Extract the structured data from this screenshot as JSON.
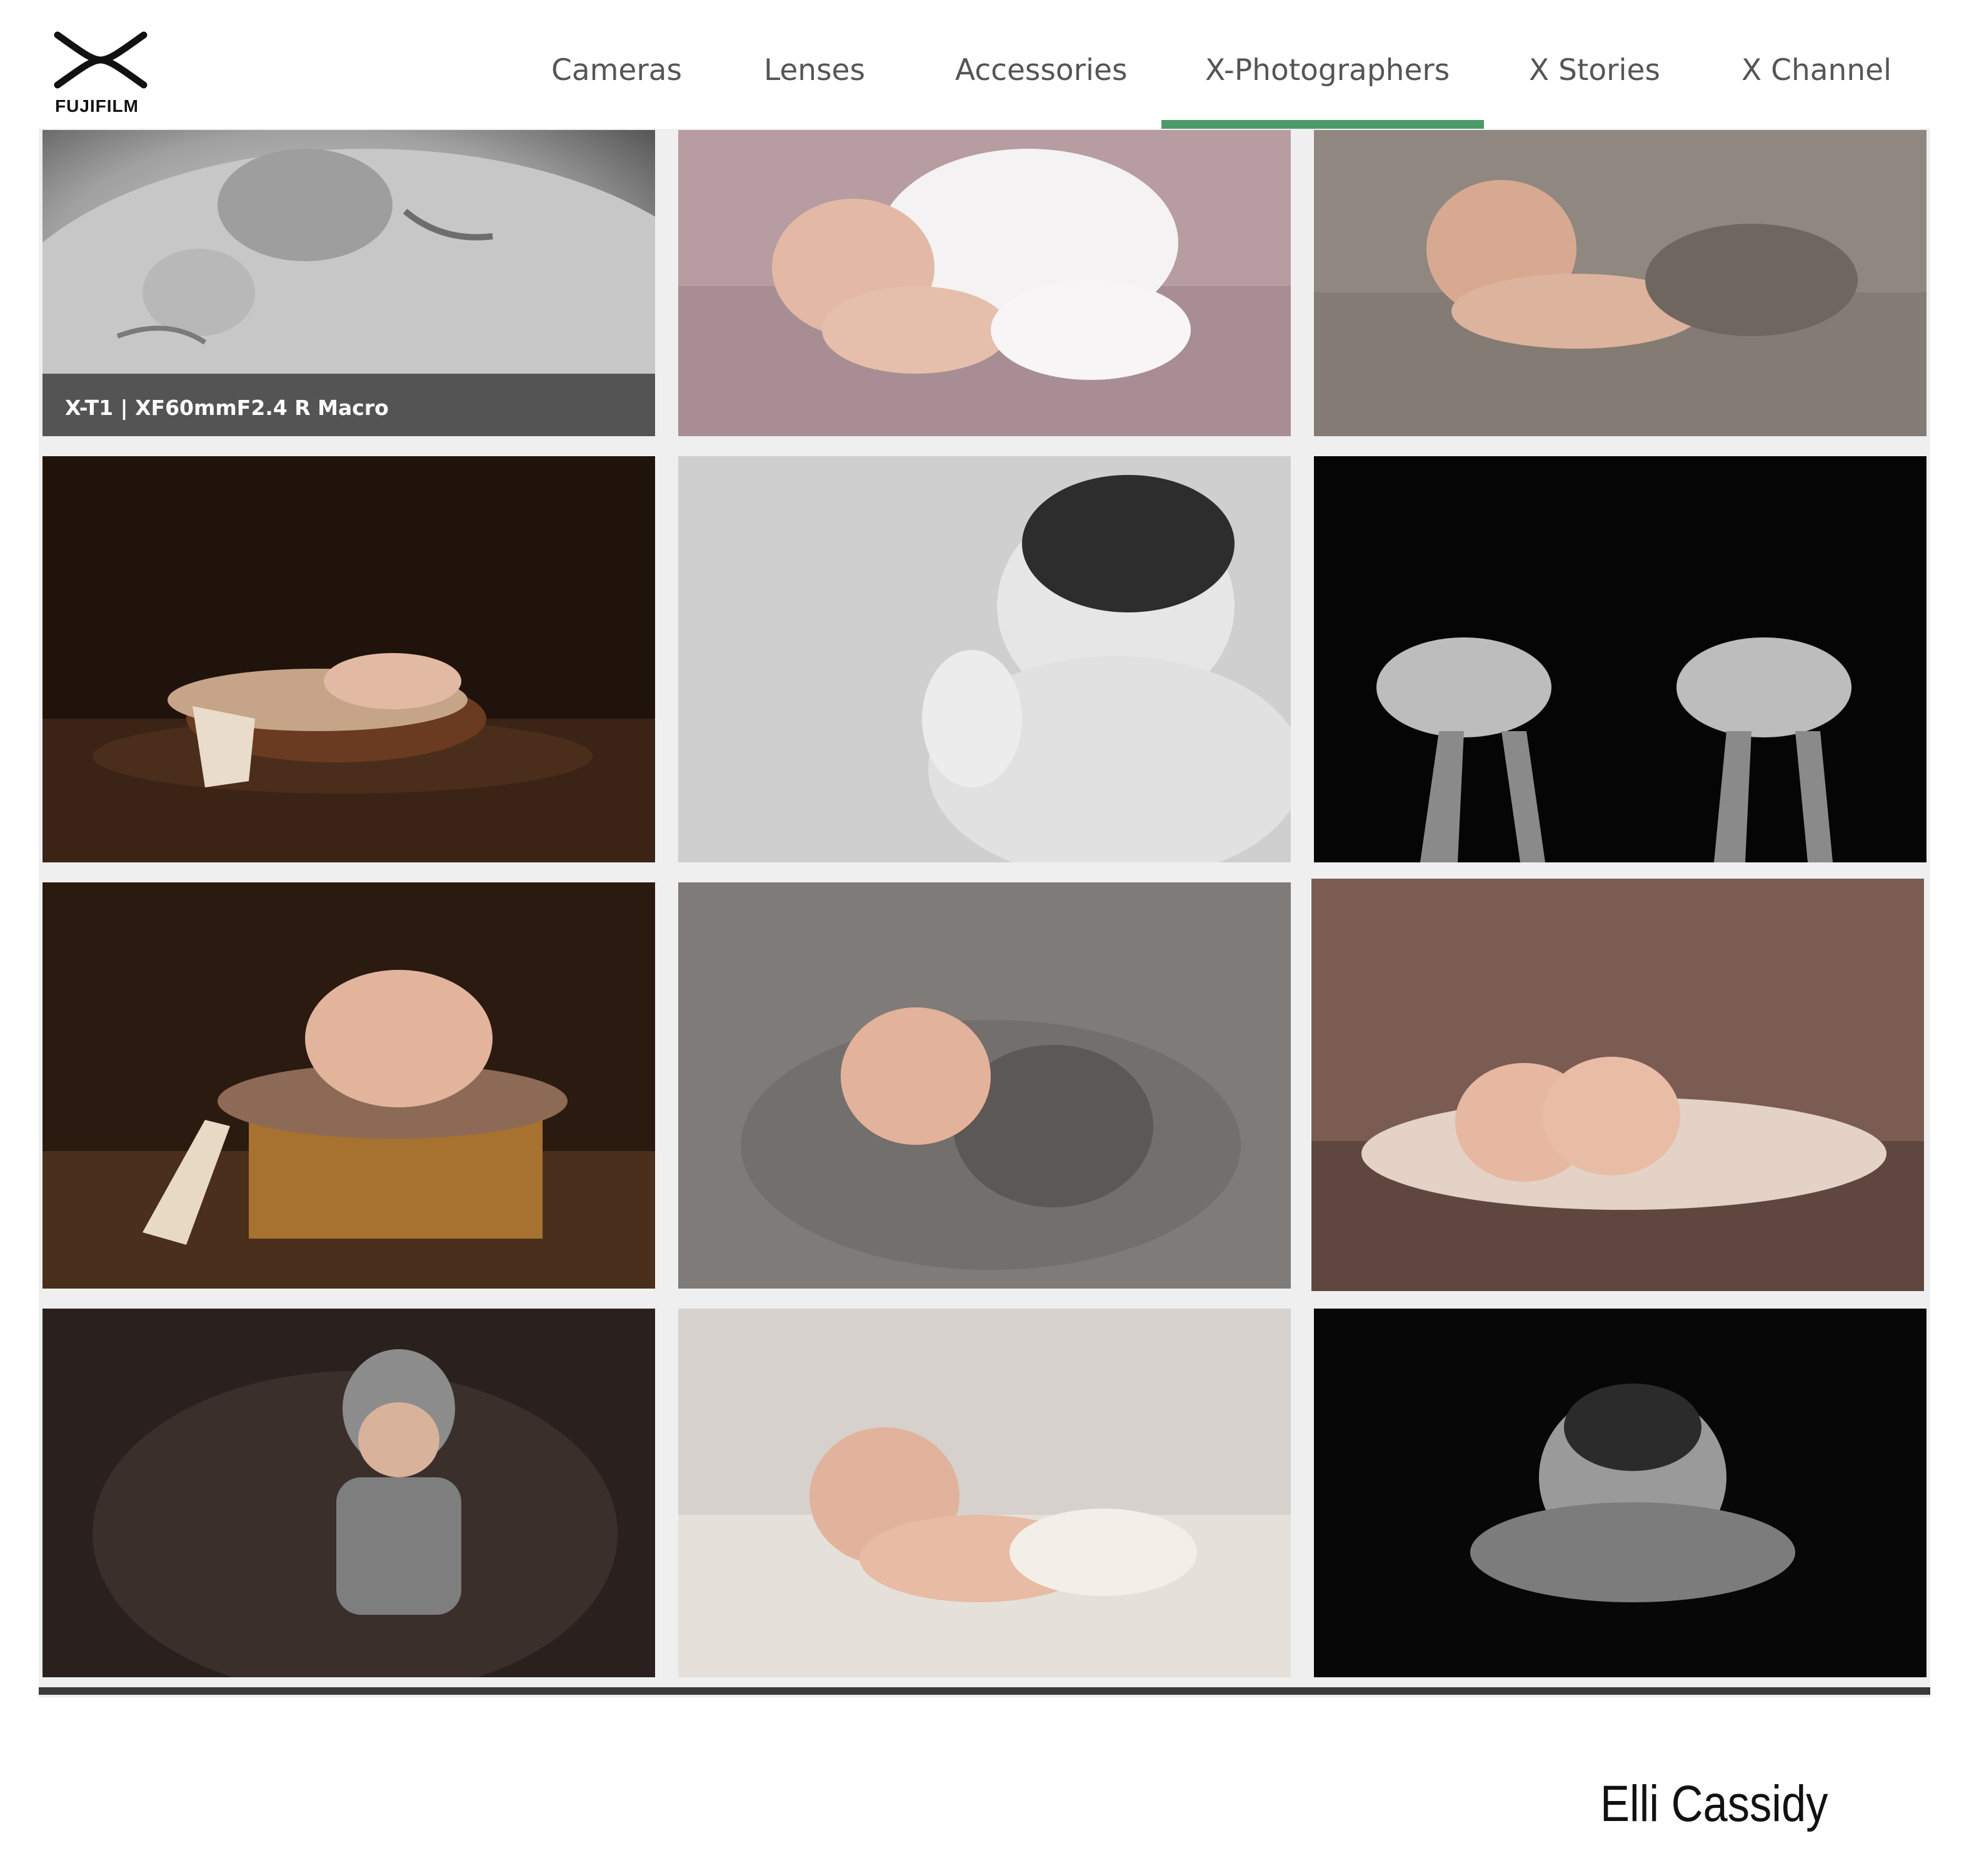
{
  "brand": {
    "logo_text": "FUJIFILM",
    "logo_icon": "x-mark-icon"
  },
  "nav": {
    "items": [
      {
        "label": "Cameras"
      },
      {
        "label": "Lenses"
      },
      {
        "label": "Accessories"
      },
      {
        "label": "X-Photographers",
        "active": true
      },
      {
        "label": "X Stories"
      },
      {
        "label": "X Channel"
      }
    ],
    "active_color": "#4c9a6a"
  },
  "gallery": {
    "tiles": [
      {
        "subject": "close-up sleeping newborn face, black and white",
        "caption": "X-T1 | XF60mmF2.4 R Macro"
      },
      {
        "subject": "newborn on pink blanket with white lace wrap"
      },
      {
        "subject": "newborn on grey blanket"
      },
      {
        "subject": "newborn in wooden bowl on dark wood floor"
      },
      {
        "subject": "newborn close-up on textured blanket, black and white"
      },
      {
        "subject": "twin newborns held in hands, black background"
      },
      {
        "subject": "newborn asleep on wooden lobster crate"
      },
      {
        "subject": "newborn wrapped in grey with headband"
      },
      {
        "subject": "twin newborns with headbands on brown backdrop"
      },
      {
        "subject": "newborn in knit bonnet and overalls on brown fur"
      },
      {
        "subject": "newborn on cream blanket"
      },
      {
        "subject": "newborn cradled in hands, black and white"
      }
    ]
  },
  "signature": "Elli Cassidy",
  "colors": {
    "nav_text": "#555555",
    "gallery_bg": "#efefef",
    "rule": "#3a3a3a"
  }
}
